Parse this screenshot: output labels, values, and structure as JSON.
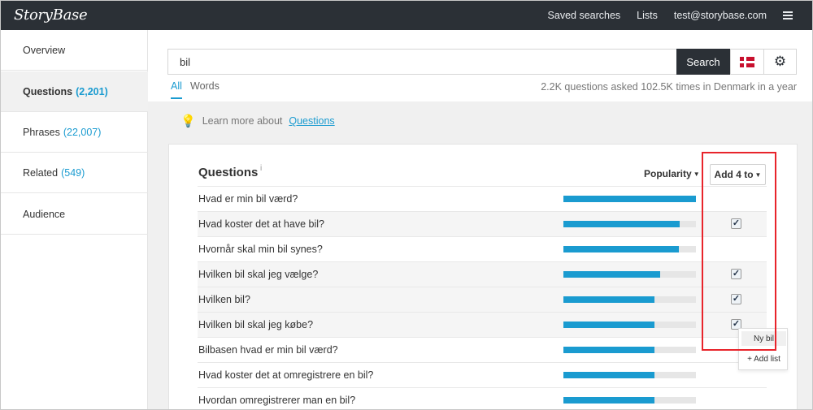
{
  "app": {
    "logo": "StoryBase",
    "links": [
      "Saved searches",
      "Lists",
      "test@storybase.com"
    ],
    "menu_icon": "hamburger-icon"
  },
  "sidebar": {
    "items": [
      {
        "label": "Overview",
        "count": ""
      },
      {
        "label": "Questions",
        "count": "(2,201)"
      },
      {
        "label": "Phrases",
        "count": "(22,007)"
      },
      {
        "label": "Related",
        "count": "(549)"
      },
      {
        "label": "Audience",
        "count": ""
      }
    ],
    "active_index": 1
  },
  "search": {
    "value": "bil",
    "button_label": "Search",
    "flag_icon": "denmark-flag-icon",
    "settings_icon": "gear-icon"
  },
  "tabs": {
    "all": "All",
    "words": "Words"
  },
  "summary": "2.2K questions asked 102.5K times in Denmark in a year",
  "learn": {
    "text": "Learn more about",
    "link": "Questions",
    "icon": "lightbulb-icon"
  },
  "questions": {
    "title": "Questions",
    "info_glyph": "i",
    "sort_label": "Popularity",
    "add_label": "Add 4 to",
    "rows": [
      {
        "text": "Hvad er min bil værd?",
        "popularity": 1.0,
        "checked": false
      },
      {
        "text": "Hvad koster det at have bil?",
        "popularity": 0.88,
        "checked": true
      },
      {
        "text": "Hvornår skal min bil synes?",
        "popularity": 0.87,
        "checked": false
      },
      {
        "text": "Hvilken bil skal jeg vælge?",
        "popularity": 0.73,
        "checked": true
      },
      {
        "text": "Hvilken bil?",
        "popularity": 0.69,
        "checked": true
      },
      {
        "text": "Hvilken bil skal jeg købe?",
        "popularity": 0.69,
        "checked": true
      },
      {
        "text": "Bilbasen hvad er min bil værd?",
        "popularity": 0.69,
        "checked": false
      },
      {
        "text": "Hvad koster det at omregistrere en bil?",
        "popularity": 0.69,
        "checked": false
      },
      {
        "text": "Hvordan omregistrerer man en bil?",
        "popularity": 0.69,
        "checked": false
      }
    ]
  },
  "dropdown": {
    "items": [
      "Ny bil",
      "+ Add list"
    ]
  },
  "colors": {
    "accent": "#1a9bd0",
    "topbar": "#2b3036",
    "highlight": "#e8242b"
  }
}
